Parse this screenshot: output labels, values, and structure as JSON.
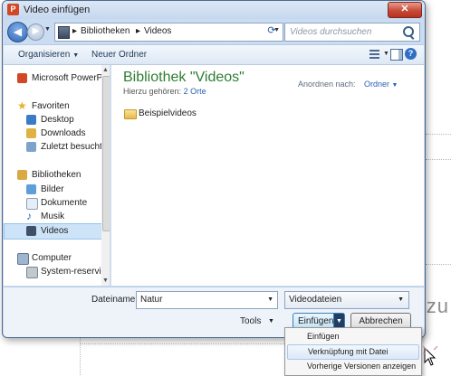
{
  "window": {
    "title": "Video einfügen",
    "close_glyph": "✕"
  },
  "address": {
    "breadcrumbs": [
      "Bibliotheken",
      "Videos"
    ],
    "separator": "▸",
    "search_placeholder": "Videos durchsuchen"
  },
  "toolbar": {
    "organize_label": "Organisieren",
    "new_folder_label": "Neuer Ordner",
    "help_glyph": "?"
  },
  "nav": {
    "items": [
      {
        "label": "Microsoft PowerPo",
        "icon": "powerpoint-icon"
      },
      {
        "label": "Favoriten",
        "icon": "star-icon"
      },
      {
        "label": "Desktop",
        "icon": "desktop-icon"
      },
      {
        "label": "Downloads",
        "icon": "downloads-icon"
      },
      {
        "label": "Zuletzt besucht",
        "icon": "recent-places-icon"
      },
      {
        "label": "Bibliotheken",
        "icon": "libraries-icon"
      },
      {
        "label": "Bilder",
        "icon": "pictures-icon"
      },
      {
        "label": "Dokumente",
        "icon": "documents-icon"
      },
      {
        "label": "Musik",
        "icon": "music-icon"
      },
      {
        "label": "Videos",
        "icon": "videos-icon",
        "selected": true
      },
      {
        "label": "Computer",
        "icon": "computer-icon"
      },
      {
        "label": "System-reserviert",
        "icon": "drive-icon"
      }
    ]
  },
  "content": {
    "library_title": "Bibliothek \"Videos\"",
    "includes_label": "Hierzu gehören:",
    "includes_link": "2 Orte",
    "arrange_label": "Anordnen nach:",
    "arrange_value": "Ordner",
    "items": [
      {
        "label": "Beispielvideos",
        "icon": "folder-icon"
      }
    ]
  },
  "footer": {
    "filename_label": "Dateiname:",
    "filename_value": "Natur",
    "filetype_value": "Videodateien",
    "tools_label": "Tools",
    "insert_label": "Einfügen",
    "cancel_label": "Abbrechen"
  },
  "menu": {
    "items": [
      {
        "label": "Einfügen"
      },
      {
        "label": "Verknüpfung mit Datei",
        "highlighted": true
      },
      {
        "label": "Vorherige Versionen anzeigen"
      }
    ]
  },
  "background": {
    "partial_text": "nzu"
  }
}
